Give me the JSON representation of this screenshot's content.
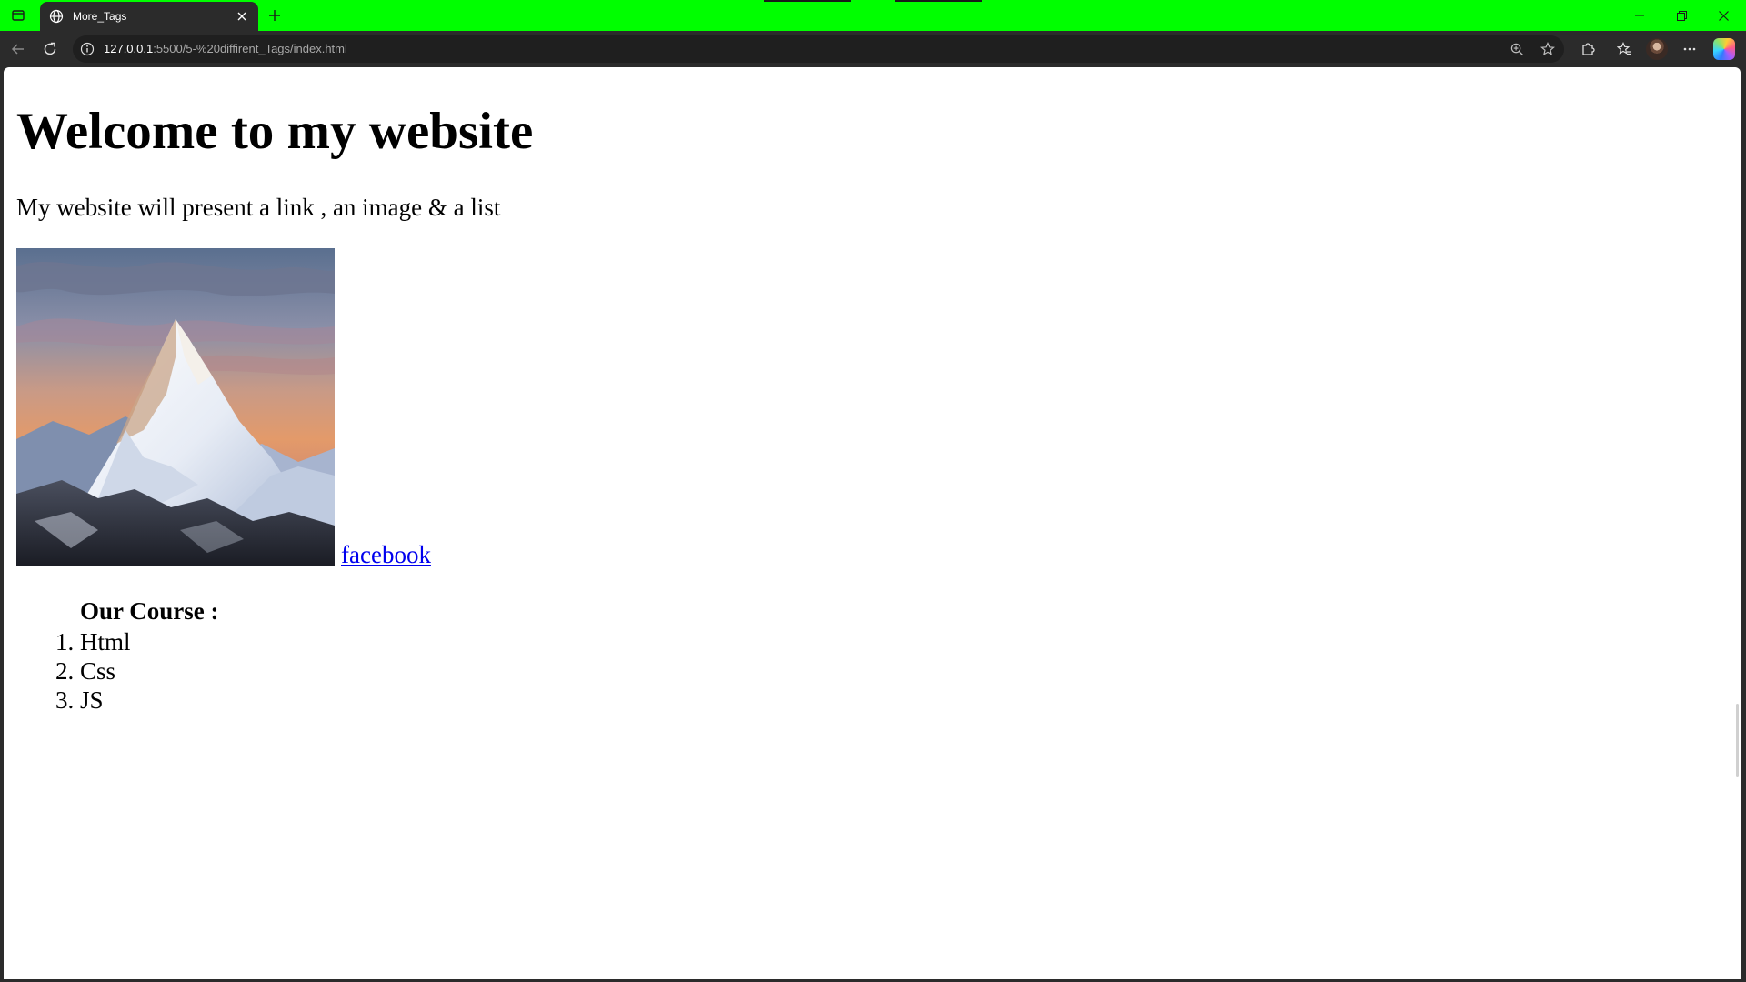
{
  "browser": {
    "tab_title": "More_Tags",
    "url_host": "127.0.0.1",
    "url_rest": ":5500/5-%20diffirent_Tags/index.html",
    "accent_color": "#00ff00"
  },
  "icons": {
    "tab_actions": "tab-actions-icon",
    "tab_favicon": "globe-icon",
    "tab_close": "close-icon",
    "new_tab": "plus-icon",
    "back": "back-arrow-icon",
    "reload": "reload-icon",
    "site_info": "info-icon",
    "zoom": "zoom-icon",
    "favorite": "star-icon",
    "extensions": "puzzle-icon",
    "favorites": "favorites-icon",
    "profile": "avatar",
    "more": "more-icon",
    "copilot": "copilot-icon",
    "minimize": "minimize-icon",
    "restore": "restore-icon",
    "close_window": "close-icon"
  },
  "page": {
    "heading": "Welcome to my website",
    "intro": "My website will present a link , an image & a list",
    "image_subject": "mountain peak at sunset",
    "link_text": "facebook",
    "course_title": "Our Course :",
    "courses": [
      "Html",
      "Css",
      "JS"
    ]
  }
}
